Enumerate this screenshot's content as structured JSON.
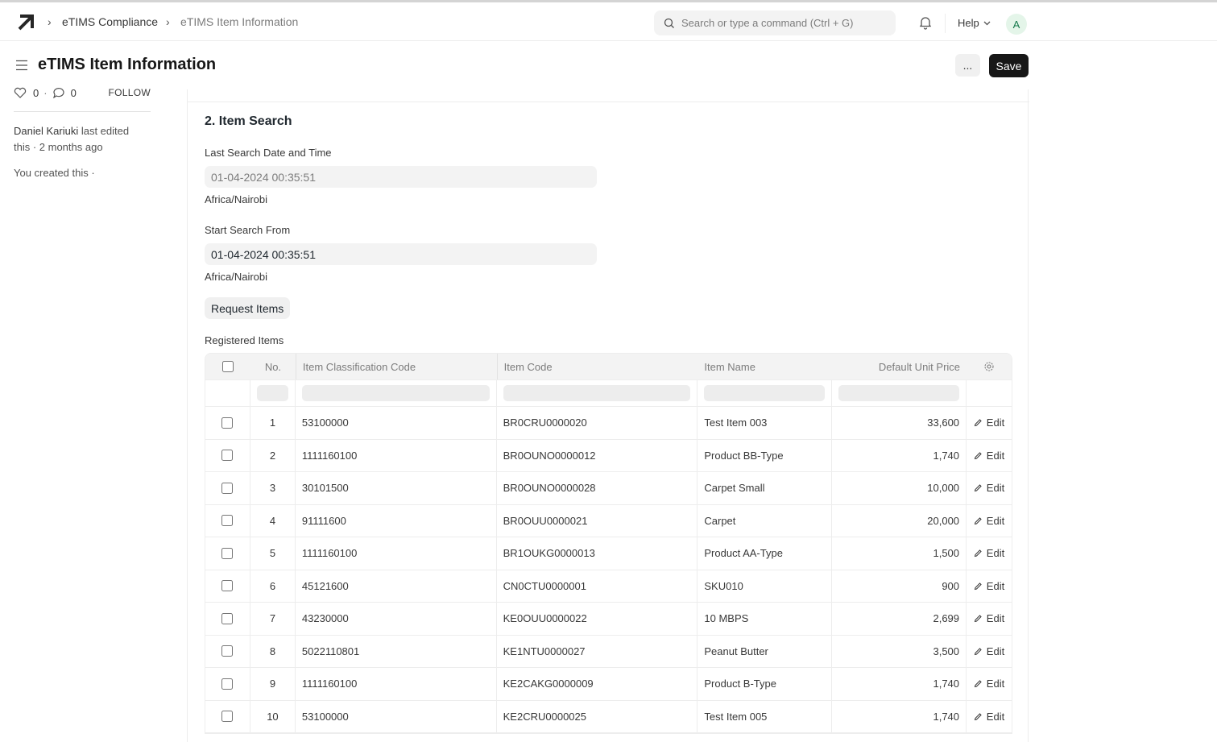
{
  "breadcrumb": [
    "eTIMS Compliance",
    "eTIMS Item Information"
  ],
  "search": {
    "placeholder": "Search or type a command (Ctrl + G)"
  },
  "help_label": "Help",
  "avatar_initial": "A",
  "page_title": "eTIMS Item Information",
  "actions": {
    "more_label": "...",
    "save_label": "Save"
  },
  "sidebar": {
    "likes": "0",
    "dot": "·",
    "comments": "0",
    "follow_label": "FOLLOW",
    "editor_name": "Daniel Kariuki",
    "edited_text": "last edited this · 2 months ago",
    "created_text": "You created this ·"
  },
  "section": {
    "title": "2. Item Search",
    "last_search_label": "Last Search Date and Time",
    "last_search_value": "01-04-2024 00:35:51",
    "last_search_tz": "Africa/Nairobi",
    "start_from_label": "Start Search From",
    "start_from_value": "01-04-2024 00:35:51",
    "start_from_tz": "Africa/Nairobi",
    "request_button": "Request Items",
    "registered_label": "Registered Items"
  },
  "table": {
    "columns": [
      "No.",
      "Item Classification Code",
      "Item Code",
      "Item Name",
      "Default Unit Price"
    ],
    "edit_label": "Edit",
    "rows": [
      {
        "no": "1",
        "class_code": "53100000",
        "item_code": "BR0CRU0000020",
        "name": "Test Item 003",
        "price": "33,600"
      },
      {
        "no": "2",
        "class_code": "1111160100",
        "item_code": "BR0OUNO0000012",
        "name": "Product BB-Type",
        "price": "1,740"
      },
      {
        "no": "3",
        "class_code": "30101500",
        "item_code": "BR0OUNO0000028",
        "name": "Carpet Small",
        "price": "10,000"
      },
      {
        "no": "4",
        "class_code": "91111600",
        "item_code": "BR0OUU0000021",
        "name": "Carpet",
        "price": "20,000"
      },
      {
        "no": "5",
        "class_code": "1111160100",
        "item_code": "BR1OUKG0000013",
        "name": "Product AA-Type",
        "price": "1,500"
      },
      {
        "no": "6",
        "class_code": "45121600",
        "item_code": "CN0CTU0000001",
        "name": "SKU010",
        "price": "900"
      },
      {
        "no": "7",
        "class_code": "43230000",
        "item_code": "KE0OUU0000022",
        "name": "10 MBPS",
        "price": "2,699"
      },
      {
        "no": "8",
        "class_code": "5022110801",
        "item_code": "KE1NTU0000027",
        "name": "Peanut Butter",
        "price": "3,500"
      },
      {
        "no": "9",
        "class_code": "1111160100",
        "item_code": "KE2CAKG0000009",
        "name": "Product B-Type",
        "price": "1,740"
      },
      {
        "no": "10",
        "class_code": "53100000",
        "item_code": "KE2CRU0000025",
        "name": "Test Item 005",
        "price": "1,740"
      }
    ]
  }
}
